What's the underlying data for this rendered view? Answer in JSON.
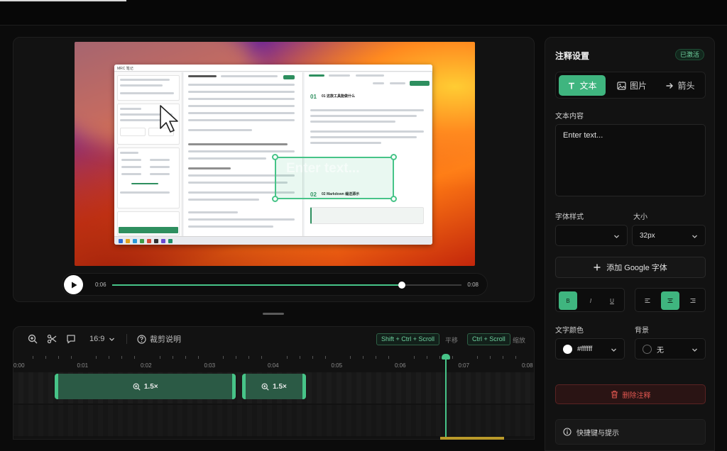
{
  "player": {
    "time_current": "0:06",
    "time_total": "0:08",
    "progress_fraction": 0.83
  },
  "video_content": {
    "annotation_text": "Enter text...",
    "window": {
      "sidebar_title": "MRC 笔记",
      "col2_title": "Markdown 素入",
      "col3_heading1": "01 这款工具能做什么",
      "col3_heading2": "02 Markdown 编送源示",
      "big_text": "Ent"
    }
  },
  "timeline": {
    "toolbar": {
      "aspect_ratio": "16:9",
      "help_label": "裁剪说明",
      "pan_shortcut": "Shift + Ctrl + Scroll",
      "pan_label": "平移",
      "zoom_shortcut": "Ctrl + Scroll",
      "zoom_label": "缩放"
    },
    "ruler": [
      "0:00",
      "0:01",
      "0:02",
      "0:03",
      "0:04",
      "0:05",
      "0:06",
      "0:07",
      "0:08"
    ],
    "clips": [
      {
        "label": "1.5×",
        "start": 0.55,
        "end": 3.4
      },
      {
        "label": "1.5×",
        "start": 3.5,
        "end": 4.5
      }
    ],
    "playhead_time": 6.7,
    "duration": 8
  },
  "panel": {
    "title": "注释设置",
    "status_badge": "已激活",
    "tabs": [
      {
        "label": "文本",
        "icon": "text-icon",
        "active": true
      },
      {
        "label": "图片",
        "icon": "image-icon",
        "active": false
      },
      {
        "label": "箭头",
        "icon": "arrow-right-icon",
        "active": false
      }
    ],
    "text_content_label": "文本内容",
    "text_content_value": "Enter text...",
    "font_style_label": "字体样式",
    "font_style_value": "",
    "size_label": "大小",
    "size_value": "32px",
    "add_font_label": "添加 Google 字体",
    "format_buttons": [
      "B",
      "I",
      "U"
    ],
    "align_active": "center",
    "text_color_label": "文字颜色",
    "text_color_value": "#ffffff",
    "background_label": "背景",
    "background_value": "无",
    "delete_label": "删除注释",
    "shortcuts_label": "快捷键与提示"
  },
  "colors": {
    "accent": "#3fb57f",
    "danger": "#e0564f"
  }
}
